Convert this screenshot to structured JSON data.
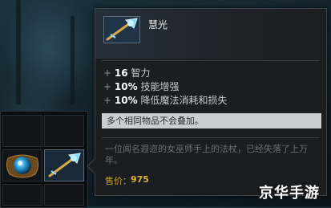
{
  "item": {
    "name": "慧光",
    "icon": "staff-icon"
  },
  "stats": [
    {
      "plus": "+",
      "value": "16",
      "label": "智力"
    },
    {
      "plus": "+",
      "value": "10%",
      "label": "技能增强"
    },
    {
      "plus": "+",
      "value": "10%",
      "label": "降低魔法消耗和损失"
    }
  ],
  "note": "多个相同物品不会叠加。",
  "lore": "一位闻名遐迩的女巫师手上的法杖，已经失落了上万年。",
  "cost": {
    "label": "售价：",
    "value": "975"
  },
  "watermark": "京华手游",
  "colors": {
    "gold": "#d8b130",
    "note_bg": "#c9ced2",
    "tooltip_bg": "#1b1e21"
  }
}
